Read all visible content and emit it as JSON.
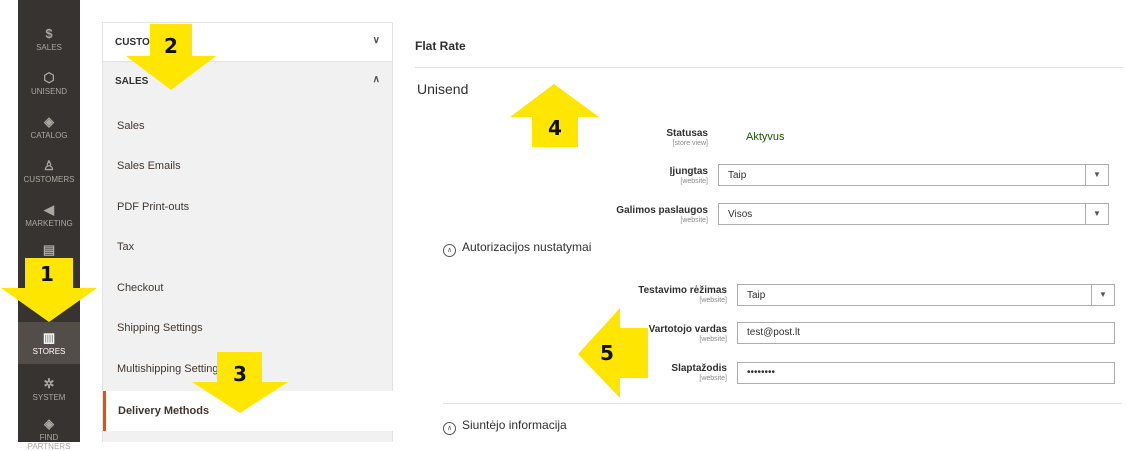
{
  "admin_nav": {
    "items": [
      {
        "label": "SALES",
        "icon": "dollar-icon"
      },
      {
        "label": "UNISEND",
        "icon": "hexagon-icon"
      },
      {
        "label": "CATALOG",
        "icon": "cube-icon"
      },
      {
        "label": "CUSTOMERS",
        "icon": "person-icon"
      },
      {
        "label": "MARKETING",
        "icon": "megaphone-icon"
      },
      {
        "label": "",
        "icon": "content-icon"
      },
      {
        "label": "STORES",
        "icon": "store-icon"
      },
      {
        "label": "SYSTEM",
        "icon": "gear-icon"
      },
      {
        "label": "FIND PARTNERS",
        "icon": "cube-icon"
      }
    ]
  },
  "sections": {
    "customers_label": "CUSTO",
    "sales_label": "SALES",
    "sales_items": [
      "Sales",
      "Sales Emails",
      "PDF Print-outs",
      "Tax",
      "Checkout",
      "Shipping Settings",
      "Multishipping Settings",
      "Delivery Methods"
    ]
  },
  "main": {
    "flat_rate": "Flat Rate",
    "unisend_title": "Unisend",
    "status_label": "Statusas",
    "status_scope": "[store view]",
    "status_value": "Aktyvus",
    "enabled_label": "Įjungtas",
    "enabled_scope": "[website]",
    "enabled_value": "Taip",
    "services_label": "Galimos paslaugos",
    "services_scope": "[website]",
    "services_value": "Visos",
    "auth_group": "Autorizacijos nustatymai",
    "test_mode_label": "Testavimo rėžimas",
    "test_mode_scope": "[website]",
    "test_mode_value": "Taip",
    "username_label": "Vartotojo vardas",
    "username_scope": "[website]",
    "username_value": "test@post.lt",
    "password_label": "Slaptažodis",
    "password_scope": "[website]",
    "password_value": "••••••••",
    "sender_group": "Siuntėjo informacija"
  },
  "badges": [
    "1",
    "2",
    "3",
    "4",
    "5"
  ],
  "colors": {
    "arrow": "#ffe600",
    "nav_bg": "#373330",
    "active_border": "#eb5202",
    "status_green": "#185b00"
  }
}
